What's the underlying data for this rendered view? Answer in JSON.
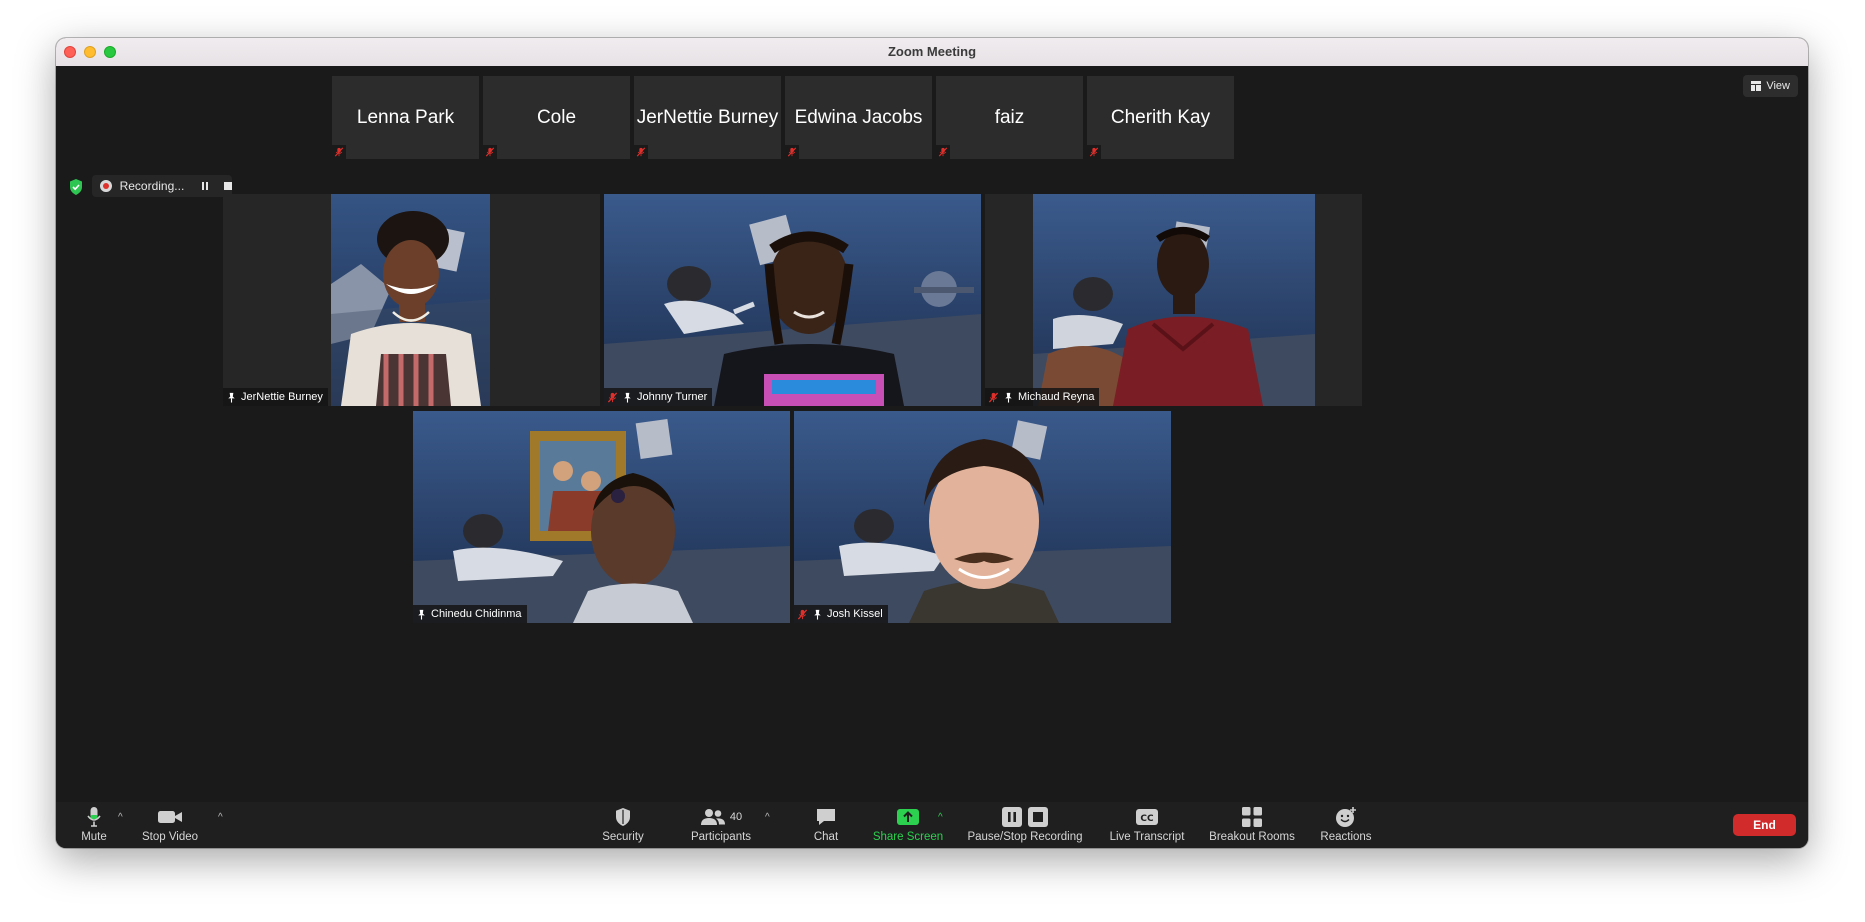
{
  "window": {
    "title": "Zoom Meeting"
  },
  "top_bar": {
    "view_label": "View"
  },
  "participant_strip": [
    {
      "name": "Lenna Park",
      "muted": true
    },
    {
      "name": "Cole",
      "muted": true
    },
    {
      "name": "JerNettie Burney",
      "muted": true
    },
    {
      "name": "Edwina Jacobs",
      "muted": true
    },
    {
      "name": "faiz",
      "muted": true
    },
    {
      "name": "Cherith Kay",
      "muted": true
    }
  ],
  "recording": {
    "label": "Recording..."
  },
  "video_tiles": [
    {
      "name": "JerNettie Burney",
      "muted": false,
      "pinned": true
    },
    {
      "name": "Johnny Turner",
      "muted": true,
      "pinned": true
    },
    {
      "name": "Michaud Reyna",
      "muted": true,
      "pinned": true
    },
    {
      "name": "Chinedu Chidinma",
      "muted": false,
      "pinned": true
    },
    {
      "name": "Josh Kissel",
      "muted": true,
      "pinned": true
    }
  ],
  "toolbar": {
    "mute": "Mute",
    "stop_video": "Stop Video",
    "security": "Security",
    "participants": "Participants",
    "participants_count": "40",
    "chat": "Chat",
    "share_screen": "Share Screen",
    "pause_stop_recording": "Pause/Stop Recording",
    "live_transcript": "Live Transcript",
    "breakout_rooms": "Breakout Rooms",
    "reactions": "Reactions",
    "end": "End"
  },
  "colors": {
    "accent_blue": "#1f6ff5",
    "share_green": "#2bd14f",
    "end_red": "#d22b2b",
    "mute_red": "#e0302c",
    "shield_green": "#2fc552"
  }
}
